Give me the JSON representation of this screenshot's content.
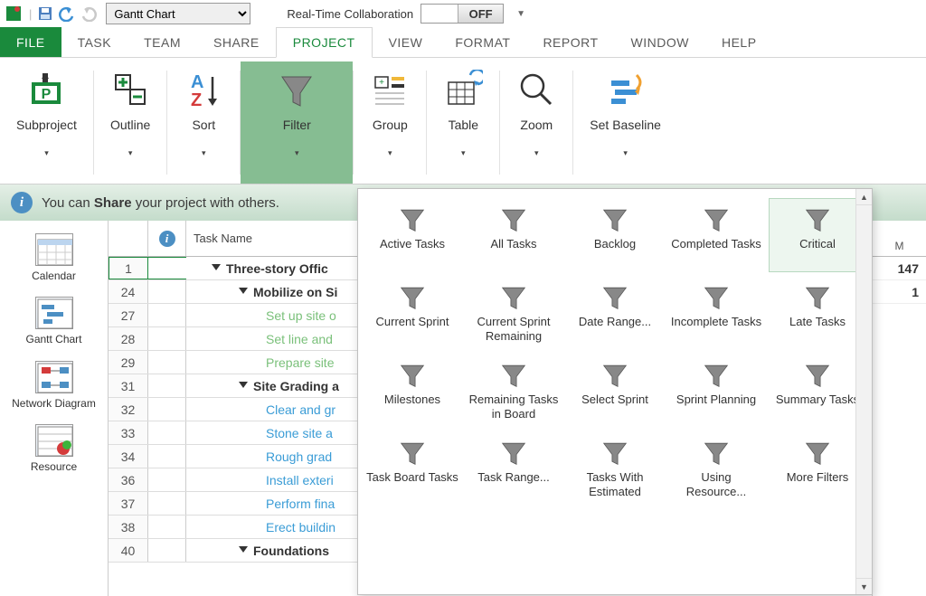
{
  "qat": {
    "view_selector": "Gantt Chart",
    "rtc_label": "Real-Time Collaboration",
    "rtc_state": "OFF"
  },
  "menu": {
    "file": "FILE",
    "task": "TASK",
    "team": "TEAM",
    "share": "SHARE",
    "project": "PROJECT",
    "view": "VIEW",
    "format": "FORMAT",
    "report": "REPORT",
    "window": "WINDOW",
    "help": "HELP"
  },
  "ribbon": {
    "subproject": "Subproject",
    "outline": "Outline",
    "sort": "Sort",
    "filter": "Filter",
    "group": "Group",
    "table": "Table",
    "zoom": "Zoom",
    "set_baseline": "Set Baseline"
  },
  "infobar": {
    "pre": "You can ",
    "bold": "Share",
    "post": " your project with others."
  },
  "viewbar": {
    "calendar": "Calendar",
    "gantt": "Gantt Chart",
    "network": "Network Diagram",
    "resource": "Resource"
  },
  "grid": {
    "headers": {
      "info": "ⓘ",
      "name": "Task Name"
    },
    "rows": [
      {
        "num": "1",
        "name": "Three-story Offic",
        "bold": true,
        "toggle": true,
        "indent": 1,
        "color": ""
      },
      {
        "num": "24",
        "name": "Mobilize on Si",
        "bold": true,
        "toggle": true,
        "indent": 2,
        "color": ""
      },
      {
        "num": "27",
        "name": "Set up site o",
        "bold": false,
        "toggle": false,
        "indent": 3,
        "color": "lgreen"
      },
      {
        "num": "28",
        "name": "Set line and",
        "bold": false,
        "toggle": false,
        "indent": 3,
        "color": "lgreen"
      },
      {
        "num": "29",
        "name": "Prepare site",
        "bold": false,
        "toggle": false,
        "indent": 3,
        "color": "lgreen"
      },
      {
        "num": "31",
        "name": "Site Grading a",
        "bold": true,
        "toggle": true,
        "indent": 2,
        "color": ""
      },
      {
        "num": "32",
        "name": "Clear and gr",
        "bold": false,
        "toggle": false,
        "indent": 3,
        "color": "lblue"
      },
      {
        "num": "33",
        "name": "Stone site a",
        "bold": false,
        "toggle": false,
        "indent": 3,
        "color": "lblue"
      },
      {
        "num": "34",
        "name": "Rough grad",
        "bold": false,
        "toggle": false,
        "indent": 3,
        "color": "lblue"
      },
      {
        "num": "36",
        "name": "Install exteri",
        "bold": false,
        "toggle": false,
        "indent": 3,
        "color": "lblue"
      },
      {
        "num": "37",
        "name": "Perform fina",
        "bold": false,
        "toggle": false,
        "indent": 3,
        "color": "lblue"
      },
      {
        "num": "38",
        "name": "Erect buildin",
        "bold": false,
        "toggle": false,
        "indent": 3,
        "color": "lblue"
      },
      {
        "num": "40",
        "name": "Foundations",
        "bold": true,
        "toggle": true,
        "indent": 2,
        "color": ""
      }
    ]
  },
  "right": {
    "header": "M",
    "vals": [
      "147",
      "1"
    ]
  },
  "filters": [
    "Active Tasks",
    "All Tasks",
    "Backlog",
    "Completed Tasks",
    "Critical",
    "Current Sprint",
    "Current Sprint Remaining",
    "Date Range...",
    "Incomplete Tasks",
    "Late Tasks",
    "Milestones",
    "Remaining Tasks in Board",
    "Select Sprint",
    "Sprint Planning",
    "Summary Tasks",
    "Task Board Tasks",
    "Task Range...",
    "Tasks With Estimated",
    "Using Resource...",
    "More Filters"
  ],
  "filter_highlight": 4
}
